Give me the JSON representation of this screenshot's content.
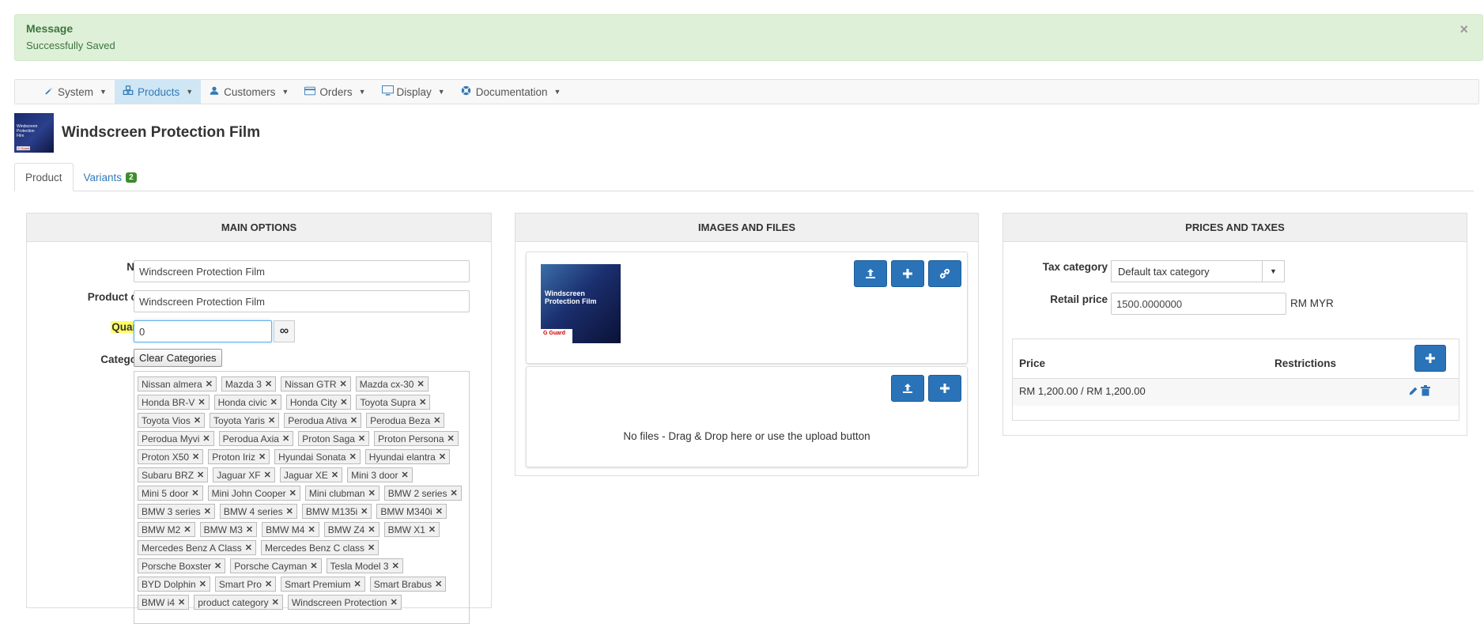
{
  "alert": {
    "title": "Message",
    "body": "Successfully Saved",
    "close": "×"
  },
  "nav": [
    {
      "icon": "wrench-icon",
      "glyph": "🔧",
      "label": "System"
    },
    {
      "icon": "cubes-icon",
      "glyph": "❖",
      "label": "Products"
    },
    {
      "icon": "user-icon",
      "glyph": "👤",
      "label": "Customers"
    },
    {
      "icon": "credit-card-icon",
      "glyph": "▭",
      "label": "Orders"
    },
    {
      "icon": "desktop-icon",
      "glyph": "🖵",
      "label": "Display"
    },
    {
      "icon": "life-ring-icon",
      "glyph": "✪",
      "label": "Documentation"
    }
  ],
  "product": {
    "title": "Windscreen Protection Film"
  },
  "tabs": {
    "product": "Product",
    "variants": "Variants",
    "variants_count": "2"
  },
  "main": {
    "heading": "MAIN OPTIONS",
    "name_label": "Name",
    "name_value": "Windscreen Protection Film",
    "code_label": "Product code",
    "code_value": "Windscreen Protection Film",
    "qty_label": "Quantity",
    "qty_value": "0",
    "infinity": "∞",
    "categories_label": "Categories",
    "clear_button": "Clear Categories",
    "categories": [
      "Nissan almera",
      "Mazda 3",
      "Nissan GTR",
      "Mazda cx-30",
      "Honda BR-V",
      "Honda civic",
      "Honda City",
      "Toyota Supra",
      "Toyota Vios",
      "Toyota Yaris",
      "Perodua Ativa",
      "Perodua Beza",
      "Perodua Myvi",
      "Perodua Axia",
      "Proton Saga",
      "Proton Persona",
      "Proton X50",
      "Proton Iriz",
      "Hyundai Sonata",
      "Hyundai elantra",
      "Subaru BRZ",
      "Jaguar XF",
      "Jaguar XE",
      "Mini 3 door",
      "Mini 5 door",
      "Mini John Cooper",
      "Mini clubman",
      "BMW 2 series",
      "BMW 3 series",
      "BMW 4 series",
      "BMW M135i",
      "BMW M340i",
      "BMW M2",
      "BMW M3",
      "BMW M4",
      "BMW Z4",
      "BMW X1",
      "Mercedes Benz A Class",
      "Mercedes Benz C class",
      "Porsche Boxster",
      "Porsche Cayman",
      "Tesla Model 3",
      "BYD Dolphin",
      "Smart Pro",
      "Smart Premium",
      "Smart Brabus",
      "BMW i4",
      "product category",
      "Windscreen Protection"
    ]
  },
  "images": {
    "heading": "IMAGES AND FILES",
    "thumb_text": "Windscreen Protection Film",
    "thumb_brand": "G Guard",
    "no_files": "No files - Drag & Drop here or use the upload button"
  },
  "prices": {
    "heading": "PRICES AND TAXES",
    "tax_label": "Tax category",
    "tax_value": "Default tax category",
    "retail_label": "Retail price",
    "retail_value": "1500.0000000",
    "currency": "RM MYR",
    "col_price": "Price",
    "col_restrictions": "Restrictions",
    "row_price": "RM 1,200.00 / RM 1,200.00"
  },
  "colors": {
    "primary": "#2a73b8",
    "success_bg": "#dff0d8",
    "highlight": "#ffff66"
  }
}
